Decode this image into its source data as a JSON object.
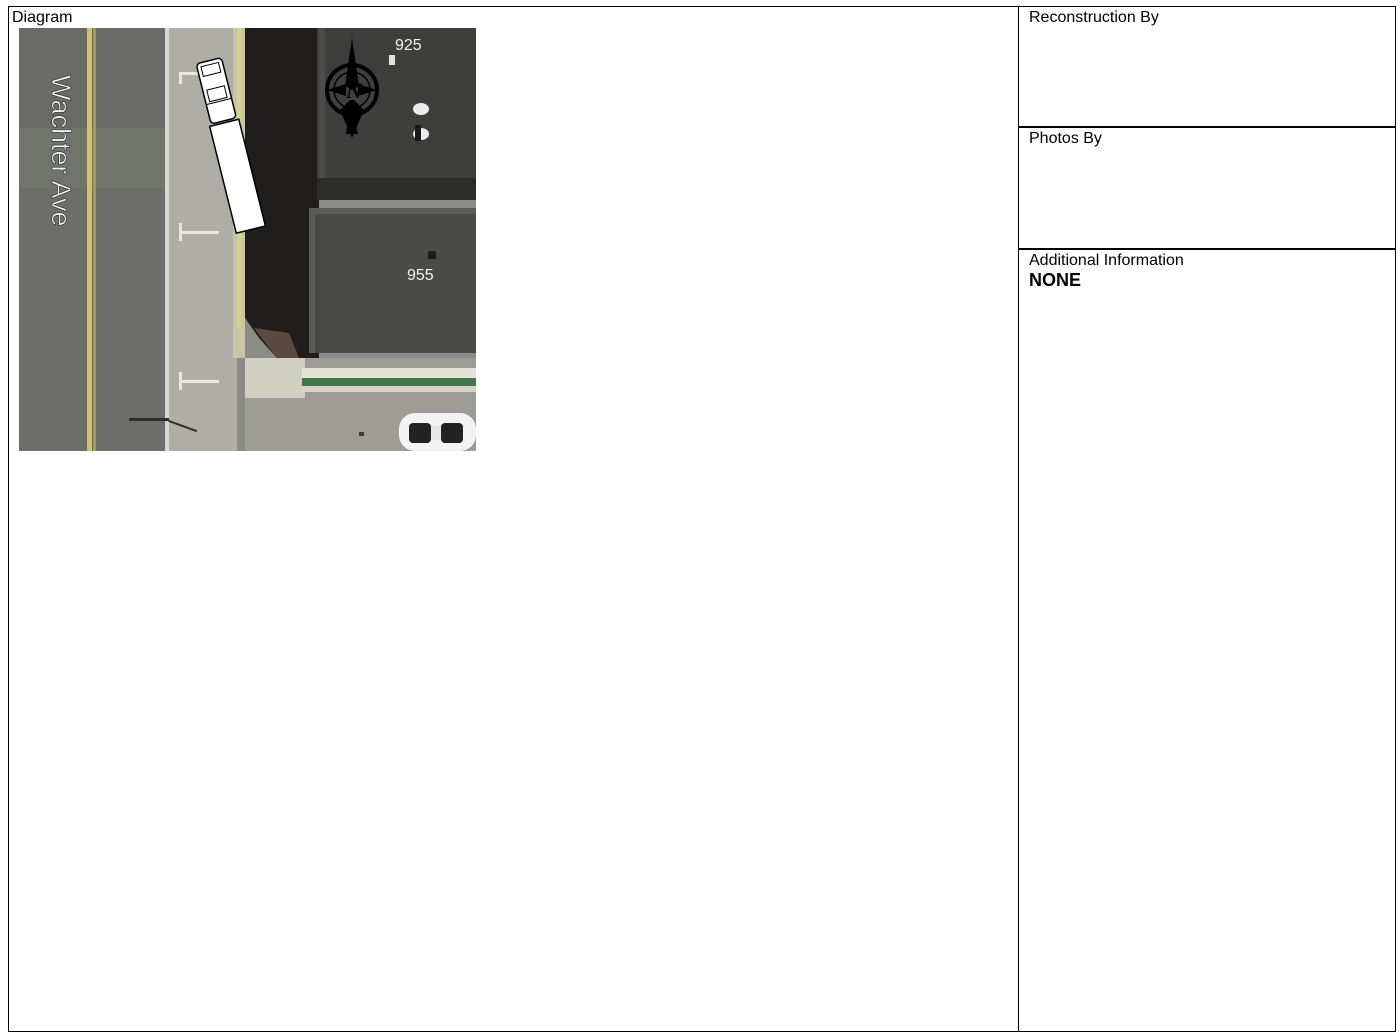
{
  "diagram": {
    "label": "Diagram",
    "map": {
      "street_name": "Wachter Ave",
      "address_top": "925",
      "address_bottom": "955",
      "compass_letter": "N",
      "icons": [
        "compass-rose-icon",
        "truck-icon",
        "car-icon"
      ]
    }
  },
  "sidebar": {
    "reconstruction_label": "Reconstruction By",
    "photos_label": "Photos By",
    "additional_info_label": "Additional Information",
    "additional_info_value": "NONE"
  }
}
